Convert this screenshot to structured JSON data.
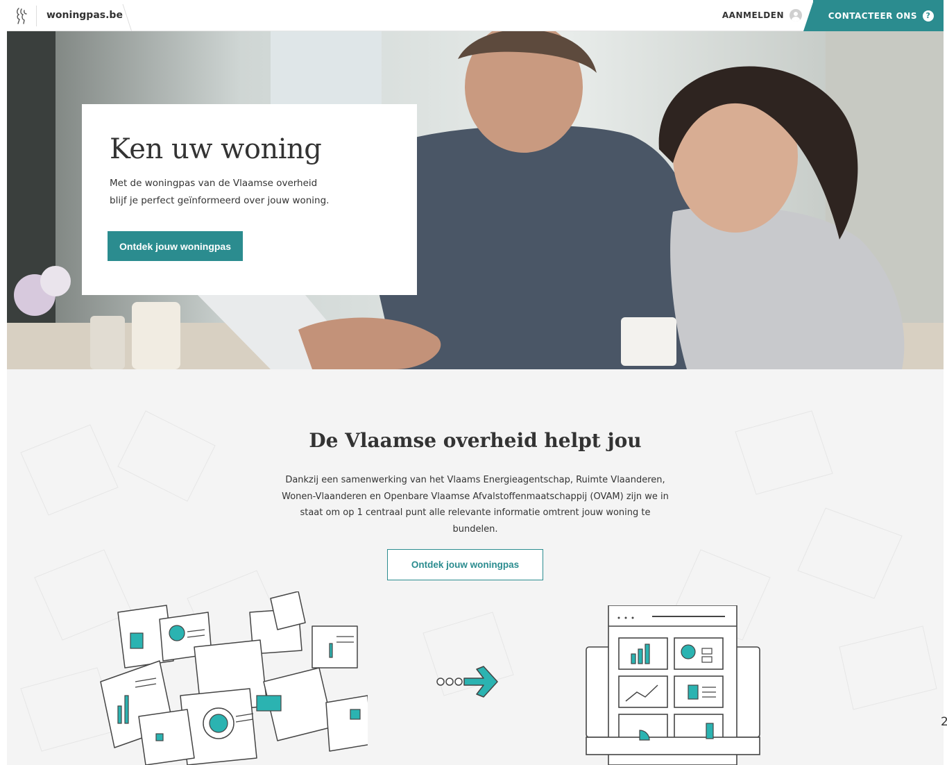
{
  "header": {
    "site_name": "woningpas.be",
    "login_label": "AANMELDEN",
    "contact_label": "CONTACTEER ONS",
    "contact_icon": "?"
  },
  "hero": {
    "title": "Ken uw woning",
    "text_line1": "Met de woningpas van de Vlaamse overheid",
    "text_line2": "blijf je perfect geïnformeerd over jouw woning.",
    "button_label": "Ontdek jouw woningpas"
  },
  "section": {
    "title": "De Vlaamse overheid helpt jou",
    "text": "Dankzij een samenwerking van het Vlaams Energieagentschap, Ruimte Vlaanderen, Wonen-Vlaanderen en Openbare Vlaamse Afvalstoffenmaatschappij (OVAM) zijn we in staat om op 1 centraal punt alle relevante informatie omtrent jouw woning te bundelen.",
    "button_label": "Ontdek jouw woningpas"
  },
  "page_number": "2",
  "colors": {
    "accent": "#2b8c8f",
    "section_bg": "#f4f4f4"
  }
}
